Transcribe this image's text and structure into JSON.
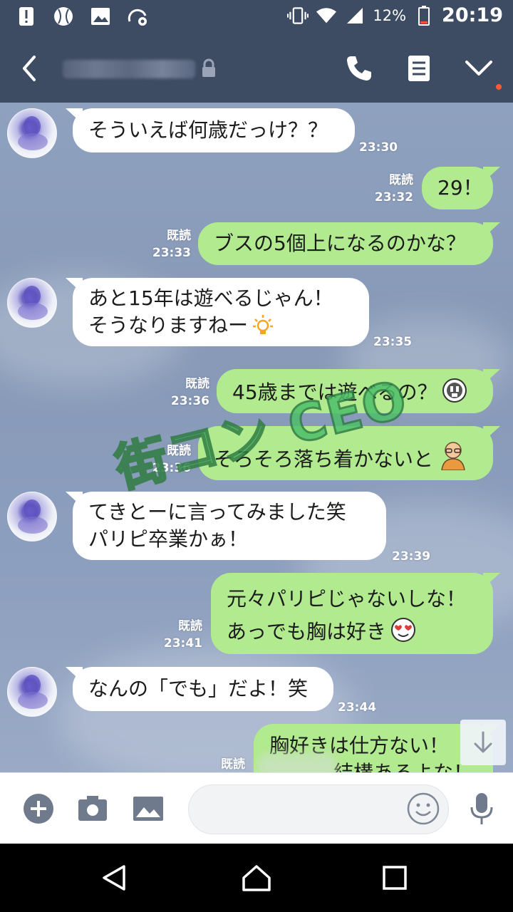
{
  "status_bar": {
    "battery_percent": "12%",
    "time": "20:19"
  },
  "header": {
    "icons": [
      "back-icon",
      "lock-icon",
      "phone-icon",
      "memo-icon",
      "chevron-down-icon"
    ]
  },
  "messages": [
    {
      "side": "in",
      "lines": [
        "そういえば何歳だっけ？？"
      ],
      "time": "23:30"
    },
    {
      "side": "out",
      "lines": [
        "29！"
      ],
      "read": "既読",
      "time": "23:32"
    },
    {
      "side": "out",
      "lines": [
        "ブスの5個上になるのかな？"
      ],
      "read": "既読",
      "time": "23:33"
    },
    {
      "side": "in",
      "lines": [
        "あと15年は遊べるじゃん！",
        "そうなりますねー"
      ],
      "time": "23:35"
    },
    {
      "side": "out",
      "lines": [
        "45歳までは遊べるの？"
      ],
      "read": "既読",
      "time": "23:36"
    },
    {
      "side": "out",
      "lines": [
        "そろそろ落ち着かないと"
      ],
      "read": "既読",
      "time": "23:36"
    },
    {
      "side": "in",
      "lines": [
        "てきとーに言ってみました笑",
        "パリピ卒業かぁ！"
      ],
      "time": "23:39"
    },
    {
      "side": "out",
      "lines": [
        "元々パリピじゃないしな！",
        "あっでも胸は好き"
      ],
      "read": "既読",
      "time": "23:41"
    },
    {
      "side": "in",
      "lines": [
        "なんの「でも」だよ！笑"
      ],
      "time": "23:44"
    },
    {
      "side": "out",
      "lines": [
        "胸好きは仕方ない！",
        "結構あるよな！"
      ],
      "read": "既読"
    }
  ],
  "watermark": "街コン CEO",
  "input_bar": {
    "icons": [
      "plus-icon",
      "camera-icon",
      "image-icon",
      "smiley-icon",
      "mic-icon"
    ]
  },
  "nav_bar": {
    "icons": [
      "back-triangle-icon",
      "home-icon",
      "recents-icon"
    ]
  }
}
